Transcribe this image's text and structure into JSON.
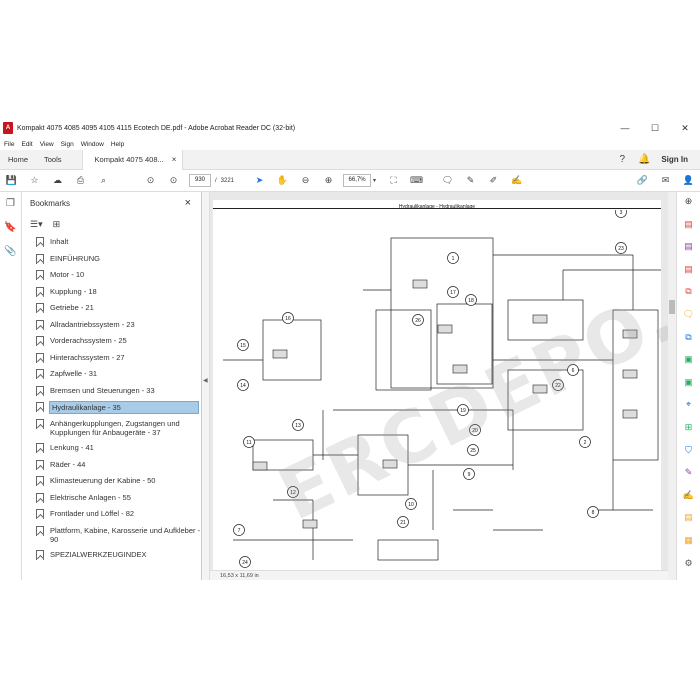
{
  "window": {
    "title": "Kompakt 4075 4085 4095 4105 4115 Ecotech DE.pdf - Adobe Acrobat Reader DC (32-bit)",
    "controls": [
      "—",
      "☐",
      "✕"
    ]
  },
  "menu": [
    "File",
    "Edit",
    "View",
    "Sign",
    "Window",
    "Help"
  ],
  "tabs": {
    "home": "Home",
    "tools": "Tools",
    "document": "Kompakt 4075 408...",
    "close": "×",
    "sign_in": "Sign In"
  },
  "toolbar": {
    "page_current": "930",
    "page_sep": "/",
    "page_total": "3221",
    "zoom": "66,7%"
  },
  "bookmarks": {
    "title": "Bookmarks",
    "close": "×",
    "items": [
      {
        "label": "Inhalt"
      },
      {
        "label": "EINFÜHRUNG"
      },
      {
        "label": "Motor - 10"
      },
      {
        "label": "Kupplung - 18"
      },
      {
        "label": "Getriebe - 21"
      },
      {
        "label": "Allradantriebssystem - 23"
      },
      {
        "label": "Vorderachssystem - 25"
      },
      {
        "label": "Hinterachssystem - 27"
      },
      {
        "label": "Zapfwelle - 31"
      },
      {
        "label": "Bremsen und Steuerungen - 33"
      },
      {
        "label": "Hydraulikanlage - 35",
        "selected": true
      },
      {
        "label": "Anhängerkupplungen, Zugstangen und Kupplungen für Anbaugeräte - 37"
      },
      {
        "label": "Lenkung - 41"
      },
      {
        "label": "Räder - 44"
      },
      {
        "label": "Klimasteuerung der Kabine - 50"
      },
      {
        "label": "Elektrische Anlagen - 55"
      },
      {
        "label": "Frontlader und Löffel - 82"
      },
      {
        "label": "Plattform, Kabine, Karosserie und Aufkleber - 90"
      },
      {
        "label": "SPEZIALWERKZEUGINDEX"
      }
    ]
  },
  "page": {
    "title": "Hydraulikanlage - Hydraulikanlage",
    "callouts": [
      "1",
      "2",
      "3",
      "6",
      "7",
      "8",
      "9",
      "10",
      "11",
      "12",
      "13",
      "14",
      "15",
      "16",
      "17",
      "18",
      "19",
      "20",
      "21",
      "22",
      "23",
      "24",
      "25",
      "26"
    ],
    "watermark": "ERCDEPO.COM"
  },
  "status": {
    "page_size": "16,53 x 11,69 in"
  },
  "colors": {
    "accent": "#1473e6",
    "selection": "#a8cbe8",
    "pdf_red": "#c4161c"
  }
}
